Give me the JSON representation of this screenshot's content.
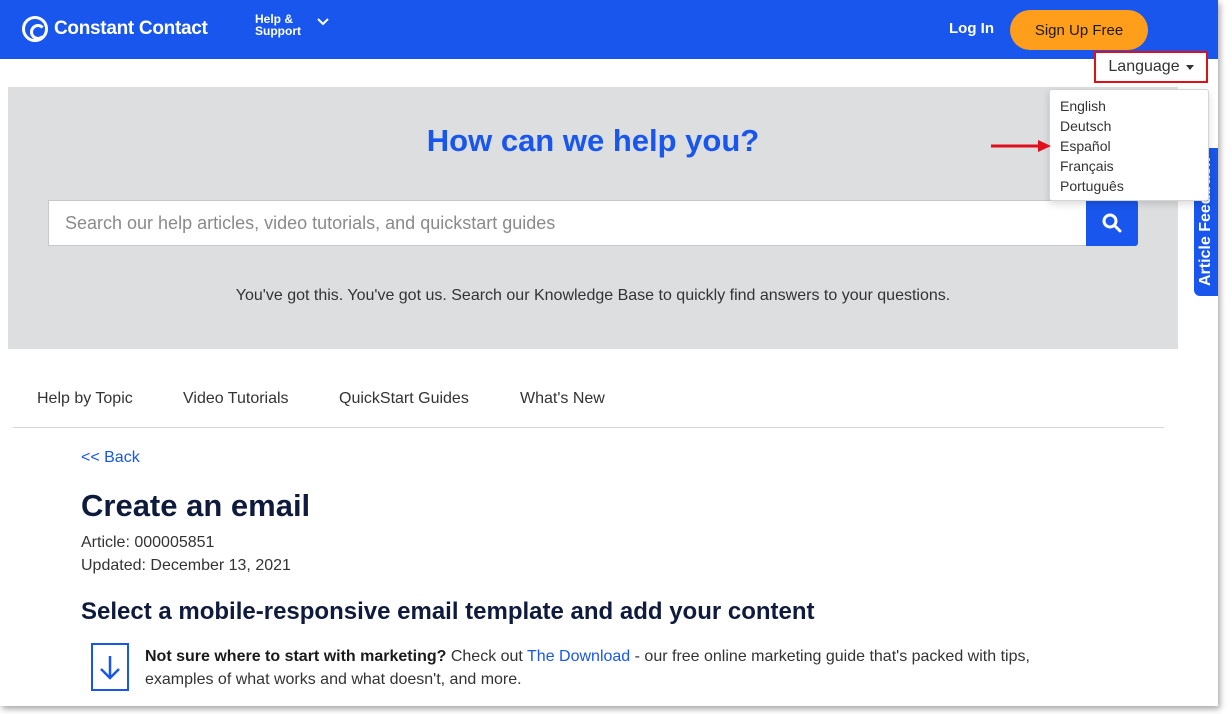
{
  "header": {
    "logo_text": "Constant Contact",
    "help_support": "Help & Support",
    "login_label": "Log In",
    "signup_label": "Sign Up Free"
  },
  "language": {
    "button_label": "Language",
    "options": [
      "English",
      "Deutsch",
      "Español",
      "Français",
      "Português"
    ]
  },
  "hero": {
    "title": "How can we help you?",
    "search_placeholder": "Search our help articles, video tutorials, and quickstart guides",
    "subtitle": "You've got this. You've got us. Search our Knowledge Base to quickly find answers to your questions."
  },
  "feedback_tab": "Article Feedback",
  "nav": {
    "items": [
      "Help by Topic",
      "Video Tutorials",
      "QuickStart Guides",
      "What's New"
    ]
  },
  "article": {
    "back_link": "<< Back",
    "title": "Create an email",
    "article_id": "Article: 000005851",
    "updated": "Updated: December 13, 2021",
    "section_heading": "Select a mobile-responsive email template and add your content",
    "tip_bold": "Not sure where to start with marketing?",
    "tip_pre_link": " Check out ",
    "tip_link": "The Download",
    "tip_post_link": " - our free online marketing guide that's packed with tips, examples of what works and what doesn't, and more."
  },
  "colors": {
    "brand_blue": "#1856ED",
    "signup_orange": "#FF9E1B",
    "highlight_red": "#e0101a",
    "hero_gray": "#DCDEE0"
  }
}
